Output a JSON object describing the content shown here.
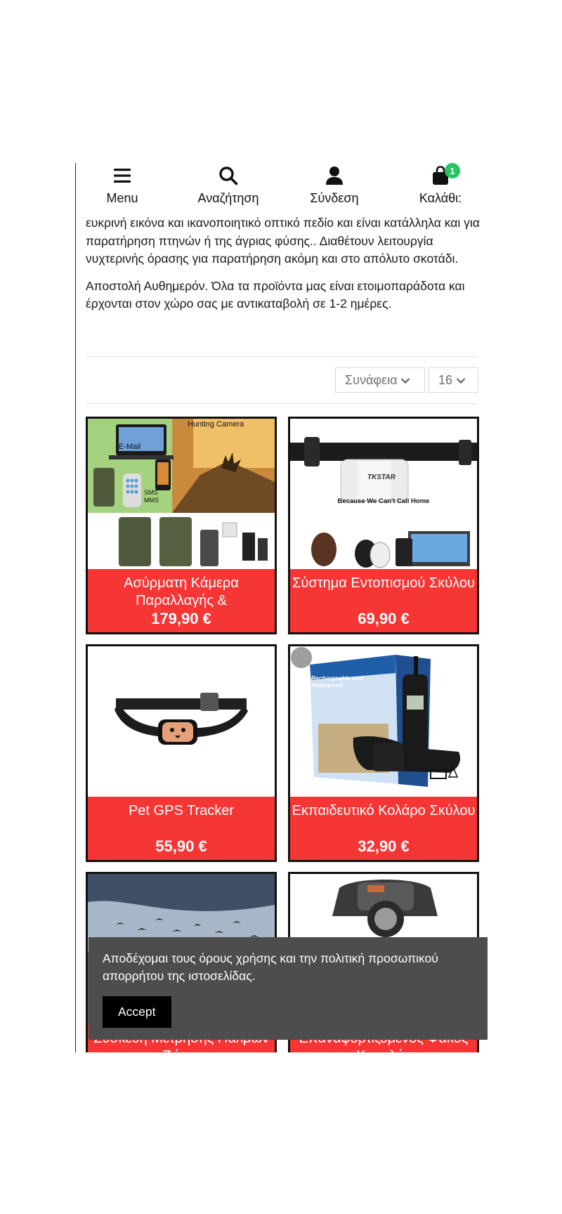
{
  "nav": {
    "items": [
      {
        "label": "Menu",
        "icon": "menu-icon"
      },
      {
        "label": "Αναζήτηση",
        "icon": "search-icon"
      },
      {
        "label": "Σύνδεση",
        "icon": "user-icon"
      },
      {
        "label": "Καλάθι:",
        "icon": "shopping-bag-icon"
      }
    ],
    "cart_count": "1"
  },
  "description": {
    "paragraph1": "ευκρινή εικόνα και ικανοποιητικό οπτικό πεδίο και είναι κατάλληλα και για παρατήρηση πτηνών ή της άγριας φύσης.. Διαθέτουν λειτουργία νυχτερινής όρασης για παρατήρηση ακόμη και στο απόλυτο σκοτάδι.",
    "paragraph2": "Αποστολή Αυθημερόν. Όλα τα προϊόντα μας είναι ετοιμοπαράδοτα και έρχονται στον χώρο σας με αντικαταβολή σε 1-2 ημέρες."
  },
  "toolbar": {
    "sort_value": "Συνάφεια",
    "per_page_value": "16"
  },
  "products": [
    {
      "title": "Ασύρματη Κάμερα Παραλλαγής &",
      "price": "179,90 €",
      "image_text_1": "Hunting Camera",
      "image_text_2": "E-Mail",
      "image_text_3": "SMS",
      "image_text_4": "MMS"
    },
    {
      "title": "Σύστημα Εντοπισμού Σκύλου",
      "price": "69,90 €",
      "image_text_1": "TKSTAR",
      "image_text_2": "Because We Can't Call Home"
    },
    {
      "title": "Pet GPS Tracker",
      "price": "55,90 €"
    },
    {
      "title": "Εκπαιδευτικό Κολάρο Σκύλου",
      "price": "32,90 €",
      "image_text_1": "Rechargeable and Waterproof"
    },
    {
      "title": "Συσκευή Μέτρησης Παλμών Ζώων",
      "price": ""
    },
    {
      "title": "Επαναφορτιζόμενος Φακός Κεφαλής",
      "price": ""
    }
  ],
  "cookie": {
    "text": "Αποδέχομαι τους όρους χρήσης και την πολιτική προσωπικού απορρήτου της ιστοσελίδας.",
    "accept_label": "Accept"
  },
  "colors": {
    "accent": "#f63535",
    "badge": "#22c55e",
    "cookie_bg": "#4d4d4d"
  }
}
